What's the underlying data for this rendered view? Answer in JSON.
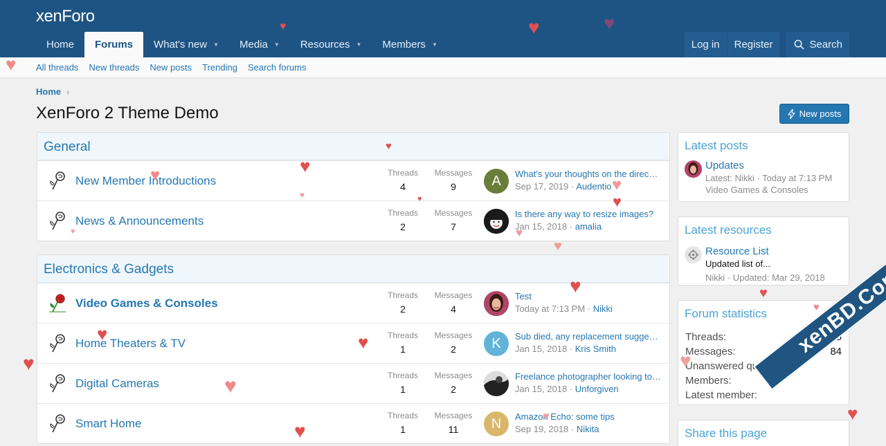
{
  "header": {
    "logo": "xenForo",
    "nav": [
      {
        "label": "Home",
        "active": false,
        "caret": false
      },
      {
        "label": "Forums",
        "active": true,
        "caret": false
      },
      {
        "label": "What's new",
        "active": false,
        "caret": true
      },
      {
        "label": "Media",
        "active": false,
        "caret": true
      },
      {
        "label": "Resources",
        "active": false,
        "caret": true
      },
      {
        "label": "Members",
        "active": false,
        "caret": true
      }
    ],
    "login": "Log in",
    "register": "Register",
    "search": "Search"
  },
  "subnav": [
    "All threads",
    "New threads",
    "New posts",
    "Trending",
    "Search forums"
  ],
  "breadcrumb": {
    "home": "Home"
  },
  "page_title": "XenForo 2 Theme Demo",
  "new_posts_button": "New posts",
  "categories": [
    {
      "name": "General",
      "nodes": [
        {
          "title": "New Member Introductions",
          "bold": false,
          "threads": "4",
          "messages": "9",
          "latest_title": "What's your thoughts on the direc…",
          "latest_date": "Sep 17, 2019",
          "latest_user": "Audentio",
          "avatar_letter": "A",
          "avatar_color": "#6b7d3a"
        },
        {
          "title": "News & Announcements",
          "bold": false,
          "threads": "2",
          "messages": "7",
          "latest_title": "Is there any way to resize images?",
          "latest_date": "Jan 15, 2018",
          "latest_user": "amalia",
          "avatar_letter": "",
          "avatar_color": "#222222"
        }
      ]
    },
    {
      "name": "Electronics & Gadgets",
      "nodes": [
        {
          "title": "Video Games & Consoles",
          "bold": true,
          "threads": "2",
          "messages": "4",
          "latest_title": "Test",
          "latest_date": "Today at 7:13 PM",
          "latest_user": "Nikki",
          "avatar_letter": "",
          "avatar_color": "#a04a6a"
        },
        {
          "title": "Home Theaters & TV",
          "bold": false,
          "threads": "1",
          "messages": "2",
          "latest_title": "Sub died, any replacement sugge…",
          "latest_date": "Jan 15, 2018",
          "latest_user": "Kris Smith",
          "avatar_letter": "K",
          "avatar_color": "#62b3d9"
        },
        {
          "title": "Digital Cameras",
          "bold": false,
          "threads": "1",
          "messages": "2",
          "latest_title": "Freelance photographer looking to…",
          "latest_date": "Jan 15, 2018",
          "latest_user": "Unforgiven",
          "avatar_letter": "",
          "avatar_color": "#555555"
        },
        {
          "title": "Smart Home",
          "bold": false,
          "threads": "1",
          "messages": "11",
          "latest_title": "Amazon Echo: some tips",
          "latest_date": "Sep 19, 2018",
          "latest_user": "Nikita",
          "avatar_letter": "N",
          "avatar_color": "#d9b66a"
        }
      ]
    }
  ],
  "labels": {
    "threads": "Threads",
    "messages": "Messages",
    "sep": " · "
  },
  "sidebar": {
    "latest_posts": {
      "title": "Latest posts",
      "post_title": "Updates",
      "post_meta": "Latest: Nikki · Today at 7:13 PM",
      "post_forum": "Video Games & Consoles"
    },
    "latest_resources": {
      "title": "Latest resources",
      "res_title": "Resource List",
      "res_desc": "Updated list of...",
      "res_meta": "Nikki · Updated: Mar 29, 2018"
    },
    "forum_statistics": {
      "title": "Forum statistics",
      "rows": [
        {
          "label": "Threads:",
          "value": "25"
        },
        {
          "label": "Messages:",
          "value": "84"
        },
        {
          "label": "Unanswered questions:",
          "value": ""
        },
        {
          "label": "Members:",
          "value": ""
        },
        {
          "label": "Latest member:",
          "value": ""
        }
      ]
    },
    "share": {
      "title": "Share this page"
    }
  },
  "watermark": "xenBD.Com",
  "colors": {
    "header": "#1d5484",
    "link": "#2577b1",
    "heart": "#e05050"
  }
}
